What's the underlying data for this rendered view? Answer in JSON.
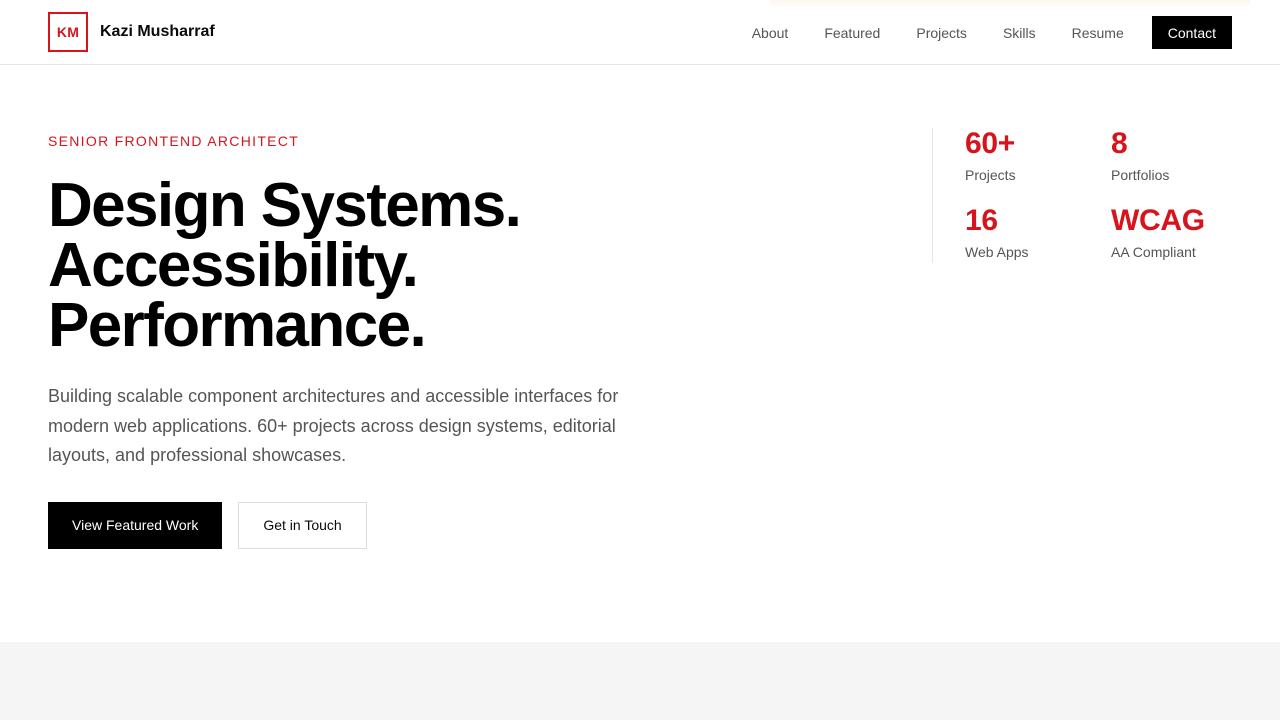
{
  "brand": {
    "initials": "KM",
    "name": "Kazi Musharraf",
    "accent_color": "#d7141c"
  },
  "nav": {
    "links": [
      "About",
      "Featured",
      "Projects",
      "Skills",
      "Resume"
    ],
    "contact_label": "Contact"
  },
  "hero": {
    "eyebrow": "SENIOR FRONTEND ARCHITECT",
    "headline": [
      "Design Systems.",
      "Accessibility.",
      "Performance."
    ],
    "lead": "Building scalable component architectures and accessible interfaces for modern web applications. 60+ projects across design systems, editorial layouts, and professional showcases.",
    "primary_cta": "View Featured Work",
    "secondary_cta": "Get in Touch"
  },
  "stats": [
    {
      "value": "60+",
      "label": "Projects"
    },
    {
      "value": "8",
      "label": "Portfolios"
    },
    {
      "value": "16",
      "label": "Web Apps"
    },
    {
      "value": "WCAG",
      "label": "AA Compliant"
    }
  ]
}
